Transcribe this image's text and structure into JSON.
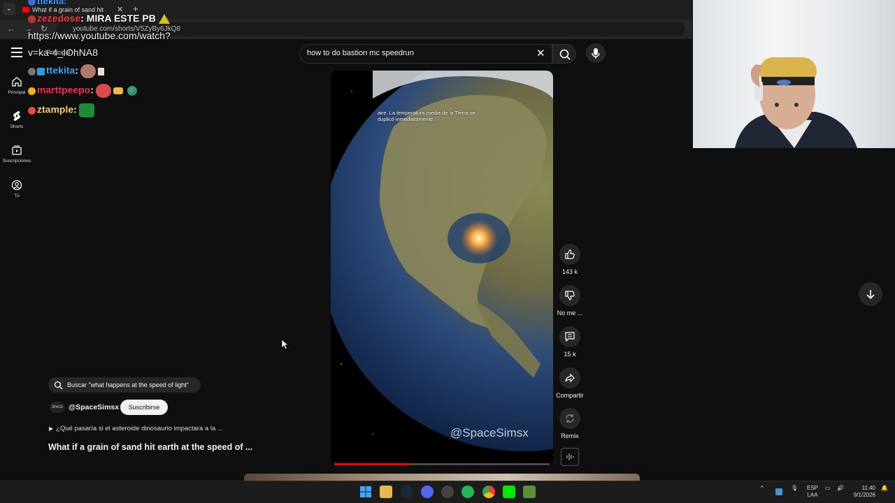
{
  "browser": {
    "tab_title": "What if a grain of sand hit",
    "url": "youtube.com/shorts/V5ZyBy6JkQ8"
  },
  "youtube": {
    "search_query": "how to do bastion mc speedrun",
    "sidebar": [
      {
        "label": "Principal",
        "icon": "home-icon"
      },
      {
        "label": "Shorts",
        "icon": "shorts-icon"
      },
      {
        "label": "Suscripciones",
        "icon": "subscriptions-icon"
      },
      {
        "label": "Tú",
        "icon": "you-icon"
      }
    ],
    "video": {
      "subtitle": "aire.  La temperatura media de la Tierra se duplicó inmediatamente.",
      "watermark": "@SpaceSimsx",
      "progress": 0.35
    },
    "actions": {
      "like_count": "143 k",
      "dislike_label": "No me ...",
      "comment_count": "15 k",
      "share_label": "Compartir",
      "remix_label": "Remix"
    },
    "meta": {
      "search_suggestion": "Buscar \"what happens at the speed of light\"",
      "channel_name": "@SpaceSimsx",
      "channel_avatar_text": "SPACE",
      "subscribe_label": "Suscribirse",
      "description": "¿Qué pasaría si el asteroide dinosaurio impactara a la ...",
      "title": "What if a grain of sand hit earth at the speed of ..."
    }
  },
  "chat_overlay": [
    {
      "user": "zezedose",
      "message": ": MIRA ESTE PB",
      "color": "#ff3b3b"
    },
    {
      "user": "",
      "message": "https://www.youtube.com/watch?",
      "color": "#ffffff"
    },
    {
      "user": "",
      "message": "v=ka-4_IOhNA8",
      "color": "#ffffff"
    },
    {
      "user": "ttekita",
      "message": ":",
      "color": "#3aa7ff"
    },
    {
      "user": "marttpeepo",
      "message": ":",
      "color": "#ff2d55"
    },
    {
      "user": "ztample",
      "message": ":",
      "color": "#ffd166"
    }
  ],
  "overlay_fragments": {
    "chat_top_user": "ttekita:",
    "sidebar_fragment": "Principal"
  },
  "taskbar": {
    "lang_top": "ESP",
    "lang_bottom": "LAA",
    "time": "11:40",
    "date": "9/1/2026"
  }
}
